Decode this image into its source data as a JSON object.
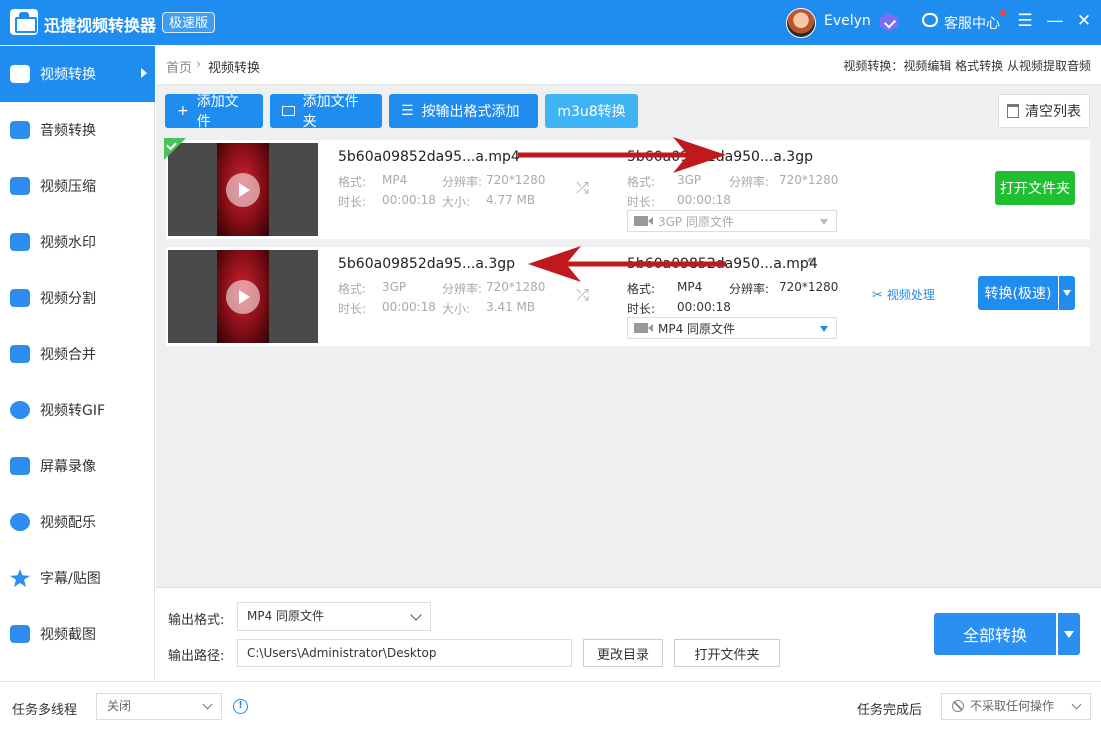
{
  "titlebar": {
    "app_title": "迅捷视频转换器",
    "badge": "极速版",
    "username": "Evelyn",
    "service": "客服中心",
    "menu_icon": "☰",
    "minimize_icon": "—",
    "close_icon": "✕"
  },
  "sidebar": {
    "items": [
      {
        "label": "视频转换",
        "icon": "video-convert-icon"
      },
      {
        "label": "音频转换",
        "icon": "audio-convert-icon"
      },
      {
        "label": "视频压缩",
        "icon": "video-compress-icon"
      },
      {
        "label": "视频水印",
        "icon": "video-watermark-icon"
      },
      {
        "label": "视频分割",
        "icon": "video-split-icon"
      },
      {
        "label": "视频合并",
        "icon": "video-merge-icon"
      },
      {
        "label": "视频转GIF",
        "icon": "video-gif-icon"
      },
      {
        "label": "屏幕录像",
        "icon": "screen-record-icon"
      },
      {
        "label": "视频配乐",
        "icon": "video-music-icon"
      },
      {
        "label": "字幕/贴图",
        "icon": "subtitle-sticker-icon"
      },
      {
        "label": "视频截图",
        "icon": "video-screenshot-icon"
      }
    ]
  },
  "breadcrumb": {
    "home": "首页",
    "sep": "›",
    "current": "视频转换",
    "tip": "视频转换：视频编辑 格式转换 从视频提取音频"
  },
  "toolbar": {
    "add_file": "添加文件",
    "add_folder": "添加文件夹",
    "add_by_format": "按输出格式添加",
    "m3u8": "m3u8转换",
    "clear": "清空列表",
    "plus_icon": "+",
    "list_icon": "☰"
  },
  "files": [
    {
      "src_name": "5b60a09852da95...a.mp4",
      "src_format_label": "格式:",
      "src_format": "MP4",
      "src_res_label": "分辨率:",
      "src_res": "720*1280",
      "src_dur_label": "时长:",
      "src_dur": "00:00:18",
      "src_size_label": "大小:",
      "src_size": "4.77 MB",
      "dst_name": "5b60a09852da950...a.3gp",
      "dst_format_label": "格式:",
      "dst_format": "3GP",
      "dst_res_label": "分辨率:",
      "dst_res": "720*1280",
      "dst_dur_label": "时长:",
      "dst_dur": "00:00:18",
      "dst_select": "3GP  同原文件",
      "action": "打开文件夹",
      "done": true
    },
    {
      "src_name": "5b60a09852da95...a.3gp",
      "src_format_label": "格式:",
      "src_format": "3GP",
      "src_res_label": "分辨率:",
      "src_res": "720*1280",
      "src_dur_label": "时长:",
      "src_dur": "00:00:18",
      "src_size_label": "大小:",
      "src_size": "3.41 MB",
      "dst_name": "5b60a09852da950...a.mp4",
      "dst_format_label": "格式:",
      "dst_format": "MP4",
      "dst_res_label": "分辨率:",
      "dst_res": "720*1280",
      "dst_dur_label": "时长:",
      "dst_dur": "00:00:18",
      "dst_select": "MP4  同原文件",
      "process": "视频处理",
      "action": "转换(极速)",
      "done": false
    }
  ],
  "output": {
    "format_label": "输出格式:",
    "format_value": "MP4  同原文件",
    "path_label": "输出路径:",
    "path_value": "C:\\Users\\Administrator\\Desktop",
    "change_dir": "更改目录",
    "open_folder": "打开文件夹",
    "convert_all": "全部转换"
  },
  "bottom": {
    "multithread_label": "任务多线程",
    "multithread_value": "关闭",
    "after_label": "任务完成后",
    "after_value": "不采取任何操作"
  },
  "colors": {
    "primary": "#1f8cf0",
    "success": "#1fbf2f",
    "annotation_arrow": "#c0191d"
  }
}
